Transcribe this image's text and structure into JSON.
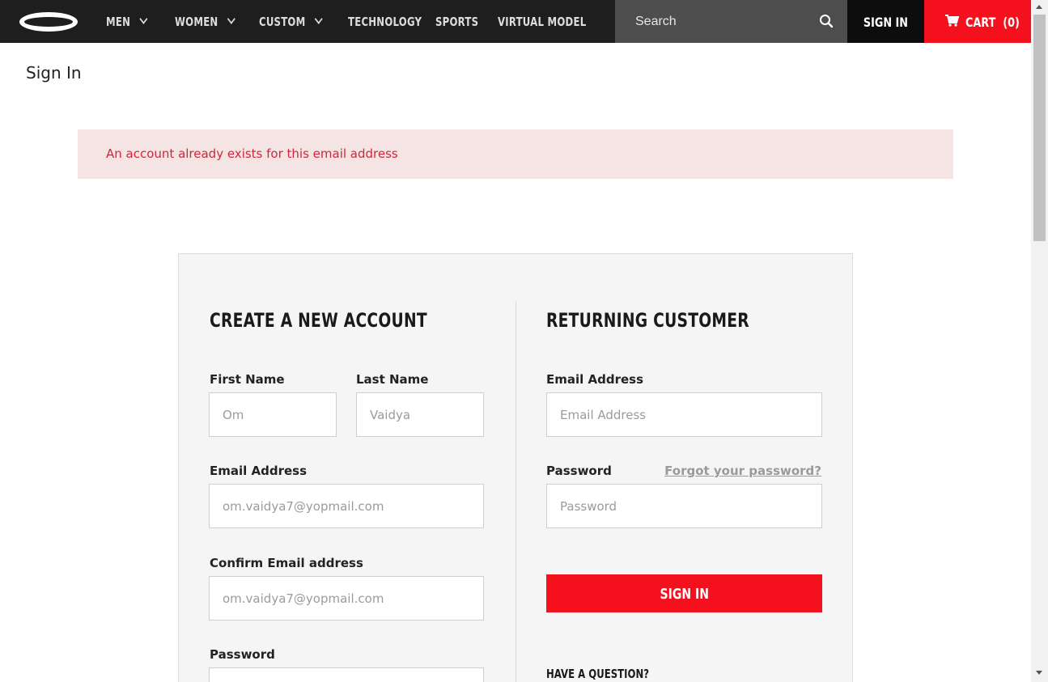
{
  "nav": {
    "logo_name": "oakley-logo",
    "items": [
      {
        "label": "MEN",
        "has_dropdown": true
      },
      {
        "label": "WOMEN",
        "has_dropdown": true
      },
      {
        "label": "CUSTOM",
        "has_dropdown": true
      },
      {
        "label": "TECHNOLOGY",
        "has_dropdown": false
      },
      {
        "label": "SPORTS",
        "has_dropdown": false
      },
      {
        "label": "VIRTUAL MODEL",
        "has_dropdown": false
      }
    ],
    "search_placeholder": "Search",
    "sign_in_label": "SIGN IN",
    "cart_label": "CART",
    "cart_count": "(0)"
  },
  "page": {
    "title": "Sign In",
    "alert_message": "An account already exists for this email address"
  },
  "create_account": {
    "heading": "CREATE A NEW ACCOUNT",
    "first_name_label": "First Name",
    "first_name_placeholder": "Om",
    "last_name_label": "Last Name",
    "last_name_placeholder": "Vaidya",
    "email_label": "Email Address",
    "email_placeholder": "om.vaidya7@yopmail.com",
    "confirm_email_label": "Confirm Email address",
    "confirm_email_placeholder": "om.vaidya7@yopmail.com",
    "password_label": "Password"
  },
  "returning_customer": {
    "heading": "RETURNING CUSTOMER",
    "email_label": "Email Address",
    "email_placeholder": "Email Address",
    "password_label": "Password",
    "forgot_password_label": "Forgot your password?",
    "password_placeholder": "Password",
    "sign_in_button_label": "SIGN IN",
    "have_question_label": "HAVE A QUESTION?"
  },
  "colors": {
    "nav_bg": "#1e1e1e",
    "search_bg": "#4d4d4d",
    "accent_red": "#f5101e",
    "alert_bg": "#f5e4e4",
    "alert_text": "#d1263a"
  }
}
